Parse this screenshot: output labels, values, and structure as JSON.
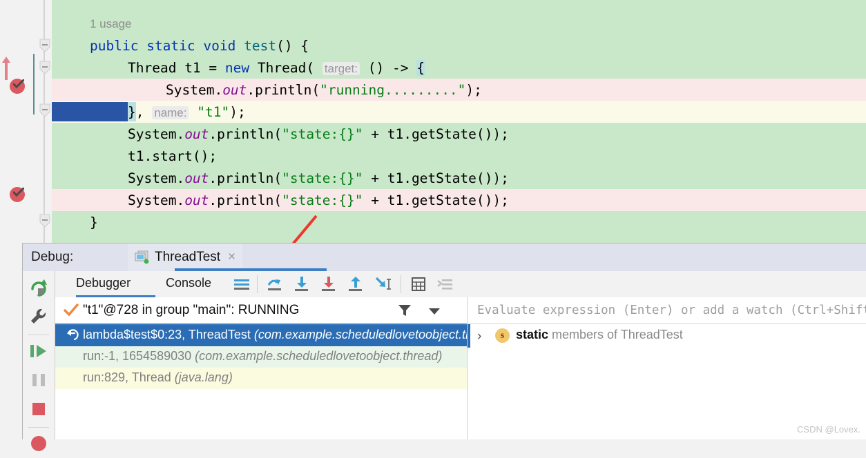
{
  "editor": {
    "usage_hint": "1 usage",
    "lines": [
      {
        "kind": "usage",
        "bg": "green",
        "text": "1 usage"
      },
      {
        "kind": "code",
        "bg": "green",
        "text": "public static void test() {"
      },
      {
        "kind": "code",
        "bg": "green",
        "text": "Thread t1 = new Thread( target: () -> {"
      },
      {
        "kind": "code",
        "bg": "pink",
        "text": "System.out.println(\"running.........\");"
      },
      {
        "kind": "code",
        "bg": "cream",
        "text": "}, name: \"t1\");"
      },
      {
        "kind": "code",
        "bg": "green",
        "text": "System.out.println(\"state:{}\" + t1.getState());"
      },
      {
        "kind": "code",
        "bg": "green",
        "text": "t1.start();"
      },
      {
        "kind": "code",
        "bg": "green",
        "text": "System.out.println(\"state:{}\" + t1.getState());"
      },
      {
        "kind": "code",
        "bg": "pink",
        "text": "System.out.println(\"state:{}\" + t1.getState());"
      },
      {
        "kind": "code",
        "bg": "green",
        "text": "}"
      }
    ],
    "tokens": {
      "kw_public": "public",
      "kw_static": "static",
      "kw_void": "void",
      "method_test": "test",
      "type_thread": "Thread",
      "var_t1": "t1",
      "kw_new": "new",
      "hint_target": "target:",
      "hint_name": "name:",
      "lambda_arrow": "() ->",
      "str_running": "\"running.........\"",
      "str_t1": "\"t1\"",
      "str_state": "\"state:{}\"",
      "call_getstate": "t1.getState()",
      "sysout": "System.",
      "field_out": "out",
      "println": ".println(",
      "start": "t1.start();"
    },
    "colors": {
      "bg_green": "#c9e7c9",
      "bg_pink": "#fae8e8",
      "bg_cream": "#fbf9e7",
      "keyword": "#0033b3",
      "string": "#067d17",
      "field": "#871094",
      "method": "#00627a",
      "selection": "#2a55a4",
      "brace_match": "#b9e0e3",
      "breakpoint": "#db5860"
    }
  },
  "annotation": {
    "arrow_color": "#f0352b",
    "points_to": "step-over-button"
  },
  "debug_window": {
    "label": "Debug:",
    "tab": {
      "title": "ThreadTest",
      "close": "×",
      "icon": "run-configuration-icon"
    },
    "sidebar": [
      {
        "name": "rerun-button",
        "icon": "rerun-icon"
      },
      {
        "name": "edit-configurations-button",
        "icon": "wrench-icon"
      },
      {
        "name": "resume-program-button",
        "icon": "resume-icon"
      },
      {
        "name": "pause-program-button",
        "icon": "pause-icon"
      },
      {
        "name": "stop-button",
        "icon": "stop-icon"
      },
      {
        "name": "view-breakpoints-button",
        "icon": "breakpoint-icon"
      }
    ],
    "tabs": [
      {
        "label": "Debugger",
        "active": true
      },
      {
        "label": "Console",
        "active": false
      }
    ],
    "toolbar": [
      {
        "name": "show-execution-point-button",
        "icon": "frames-lines-icon"
      },
      {
        "name": "step-over-button",
        "icon": "step-over-icon"
      },
      {
        "name": "step-into-button",
        "icon": "step-into-icon"
      },
      {
        "name": "force-step-into-button",
        "icon": "force-step-into-icon"
      },
      {
        "name": "step-out-button",
        "icon": "step-out-icon"
      },
      {
        "name": "run-to-cursor-button",
        "icon": "run-to-cursor-icon"
      },
      {
        "name": "evaluate-expression-button",
        "icon": "calculator-icon"
      },
      {
        "name": "mute-breakpoints-button",
        "icon": "mute-breakpoints-icon"
      }
    ],
    "thread": {
      "status_text": "\"t1\"@728 in group \"main\": RUNNING",
      "check_icon": "orange-check-icon",
      "filter_icon": "filter-icon",
      "dropdown_icon": "chevron-down-icon"
    },
    "frames": [
      {
        "selected": true,
        "icon": "return-arrow-icon",
        "main": "lambda$test$0:23, ThreadTest",
        "detail": "(com.example.scheduledlovetoobject.thread)"
      },
      {
        "selected": false,
        "icon": "",
        "main": "run:-1, 1654589030",
        "detail": "(com.example.scheduledlovetoobject.thread)"
      },
      {
        "selected": false,
        "icon": "",
        "main": "run:829, Thread",
        "detail": "(java.lang)"
      }
    ],
    "variables": {
      "evaluate_placeholder": "Evaluate expression (Enter) or add a watch (Ctrl+Shift+Enter)",
      "rows": [
        {
          "chevron": "›",
          "badge": "s",
          "label_bold": "static",
          "label_rest": " members of ThreadTest"
        }
      ]
    }
  },
  "watermark": "CSDN @Lovex."
}
